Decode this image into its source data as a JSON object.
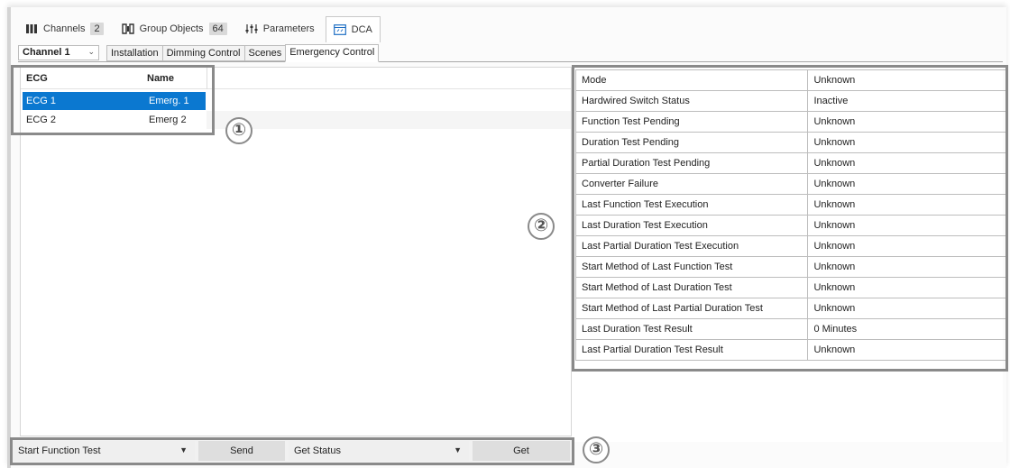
{
  "top_tabs": [
    {
      "label": "Channels",
      "count": "2",
      "icon": "channels-icon"
    },
    {
      "label": "Group Objects",
      "count": "64",
      "icon": "group-objects-icon"
    },
    {
      "label": "Parameters",
      "icon": "parameters-icon"
    },
    {
      "label": "DCA",
      "icon": "dca-icon"
    }
  ],
  "channel_select": {
    "value": "Channel 1"
  },
  "sub_tabs": [
    "Installation",
    "Dimming Control",
    "Scenes",
    "Emergency Control"
  ],
  "ecg_list": {
    "headers": [
      "ECG",
      "Name"
    ],
    "rows": [
      {
        "ecg": "ECG 1",
        "name": "Emerg. 1"
      },
      {
        "ecg": "ECG 2",
        "name": "Emerg 2"
      }
    ]
  },
  "properties": [
    {
      "key": "Mode",
      "value": "Unknown"
    },
    {
      "key": "Hardwired Switch Status",
      "value": "Inactive"
    },
    {
      "key": "Function Test Pending",
      "value": "Unknown"
    },
    {
      "key": "Duration Test Pending",
      "value": "Unknown"
    },
    {
      "key": "Partial Duration Test Pending",
      "value": "Unknown"
    },
    {
      "key": "Converter Failure",
      "value": "Unknown"
    },
    {
      "key": "Last Function Test Execution",
      "value": "Unknown"
    },
    {
      "key": "Last Duration Test Execution",
      "value": "Unknown"
    },
    {
      "key": "Last Partial Duration Test Execution",
      "value": "Unknown"
    },
    {
      "key": "Start Method of Last Function Test",
      "value": "Unknown"
    },
    {
      "key": "Start Method of Last Duration Test",
      "value": "Unknown"
    },
    {
      "key": "Start Method of Last Partial Duration Test",
      "value": "Unknown"
    },
    {
      "key": "Last Duration Test Result",
      "value": "0 Minutes"
    },
    {
      "key": "Last Partial Duration Test Result",
      "value": "Unknown"
    }
  ],
  "bottom_bar": {
    "test_dropdown": "Start Function Test",
    "send_label": "Send",
    "status_dropdown": "Get Status",
    "get_label": "Get"
  },
  "callouts": [
    "①",
    "②",
    "③"
  ],
  "colors": {
    "selection": "#0b78d0",
    "callout": "#8a8a8a"
  }
}
